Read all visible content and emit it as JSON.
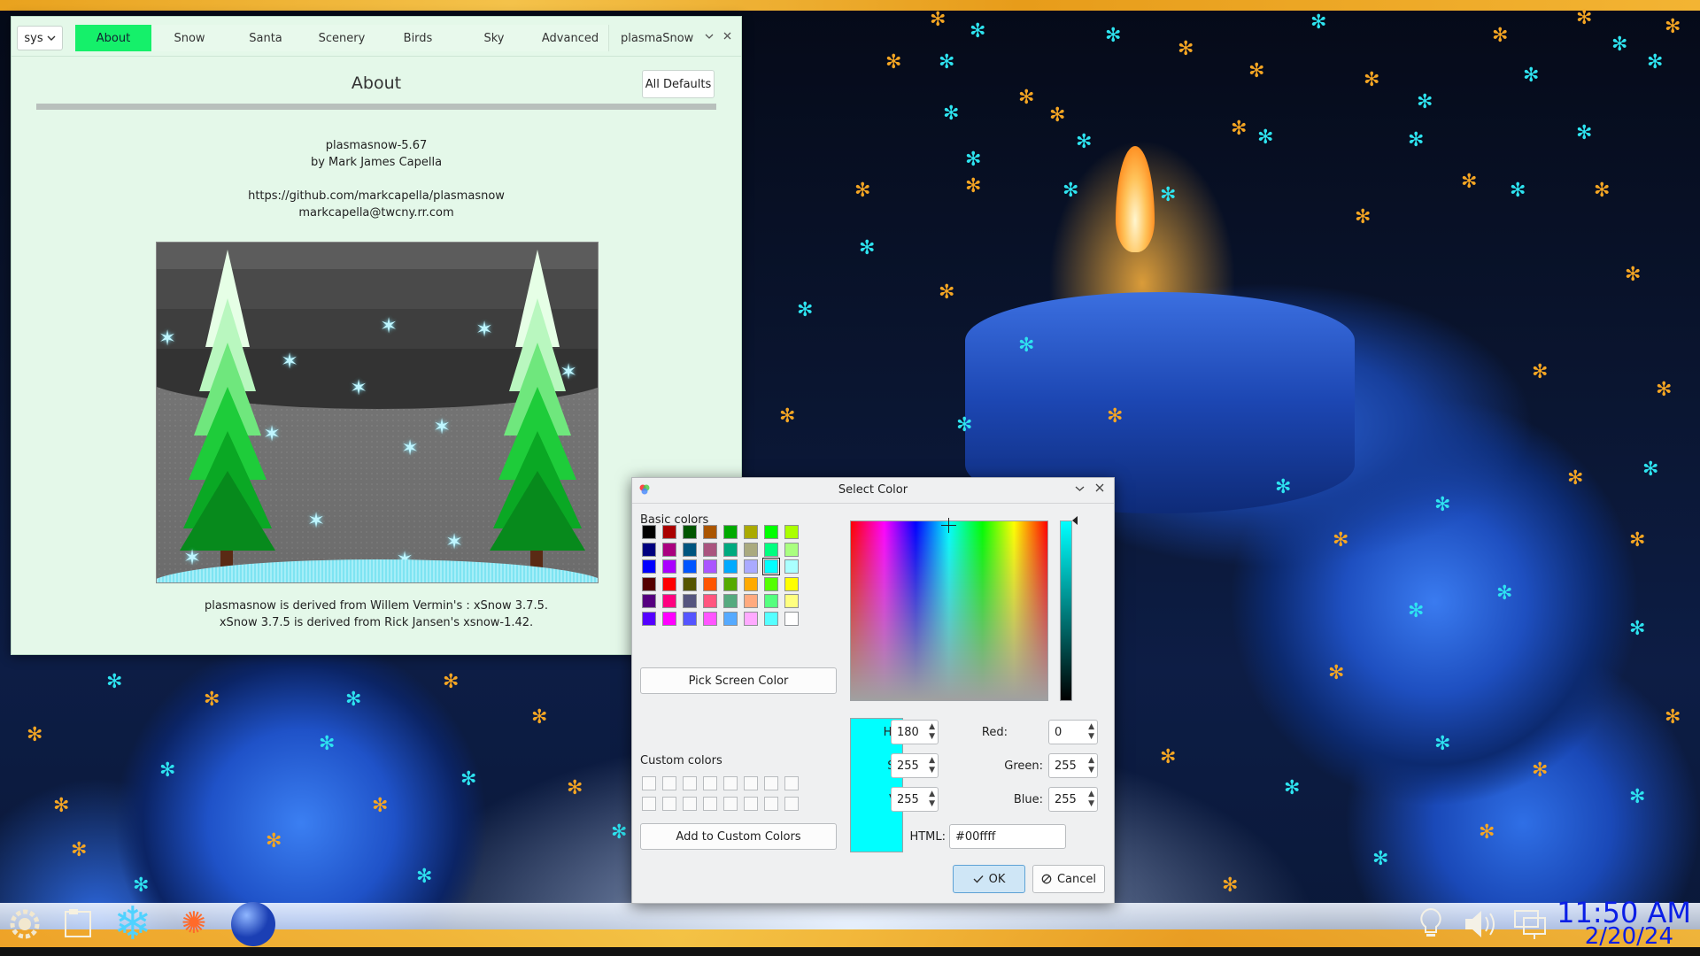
{
  "main_window": {
    "title": "plasmaSnow",
    "theme_select": "sys",
    "tabs": [
      {
        "label": "About",
        "active": true
      },
      {
        "label": "Snow"
      },
      {
        "label": "Santa"
      },
      {
        "label": "Scenery"
      },
      {
        "label": "Birds"
      },
      {
        "label": "Sky"
      },
      {
        "label": "Advanced"
      }
    ],
    "page_title": "About",
    "all_defaults_label": "All Defaults",
    "version": "plasmasnow-5.67",
    "author": "by Mark James Capella",
    "url": "https://github.com/markcapella/plasmasnow",
    "email": "markcapella@twcny.rr.com",
    "derived_1": "plasmasnow is derived from Willem Vermin's : xSnow 3.7.5.",
    "derived_2": "xSnow 3.7.5 is derived from Rick Jansen's xsnow-1.42.",
    "accent_color": "#15f06a"
  },
  "color_dialog": {
    "title": "Select Color",
    "basic_colors_label": "Basic colors",
    "basic_colors": [
      [
        "#000000",
        "#aa0000",
        "#005500",
        "#aa5500",
        "#00aa00",
        "#aaaa00",
        "#00ff00",
        "#aaff00"
      ],
      [
        "#00007f",
        "#aa007f",
        "#00557f",
        "#aa557f",
        "#00aa7f",
        "#aaaa7f",
        "#00ff7f",
        "#aaff7f"
      ],
      [
        "#0000ff",
        "#aa00ff",
        "#0055ff",
        "#aa55ff",
        "#00aaff",
        "#aaaaff",
        "#00ffff",
        "#aaffff"
      ],
      [
        "#550000",
        "#ff0000",
        "#555500",
        "#ff5500",
        "#55aa00",
        "#ffaa00",
        "#55ff00",
        "#ffff00"
      ],
      [
        "#55007f",
        "#ff007f",
        "#55557f",
        "#ff557f",
        "#55aa7f",
        "#ffaa7f",
        "#55ff7f",
        "#ffff7f"
      ],
      [
        "#5500ff",
        "#ff00ff",
        "#5555ff",
        "#ff55ff",
        "#55aaff",
        "#ffaaff",
        "#55ffff",
        "#ffffff"
      ]
    ],
    "selected_swatch": "#00ffff",
    "pick_screen_label": "Pick Screen Color",
    "custom_colors_label": "Custom colors",
    "add_custom_label": "Add to Custom Colors",
    "hue_label": "Hue:",
    "hue": "180",
    "sat_label": "Sat:",
    "sat": "255",
    "val_label": "Val:",
    "val": "255",
    "red_label": "Red:",
    "red": "0",
    "green_label": "Green:",
    "green": "255",
    "blue_label": "Blue:",
    "blue": "255",
    "html_label": "HTML:",
    "html_value": "#00ffff",
    "ok_label": "OK",
    "cancel_label": "Cancel",
    "current_color": "#00ffff"
  },
  "taskbar": {
    "time": "11:50 AM",
    "date": "2/20/24",
    "clock_color": "#0a1ee6",
    "launchers": [
      "app-launcher-icon",
      "file-manager-icon",
      "plasmasnow-snowflake-icon",
      "fireworks-icon",
      "globe-icon"
    ],
    "tray": [
      "lightbulb-icon",
      "volume-icon",
      "network-icon"
    ]
  }
}
